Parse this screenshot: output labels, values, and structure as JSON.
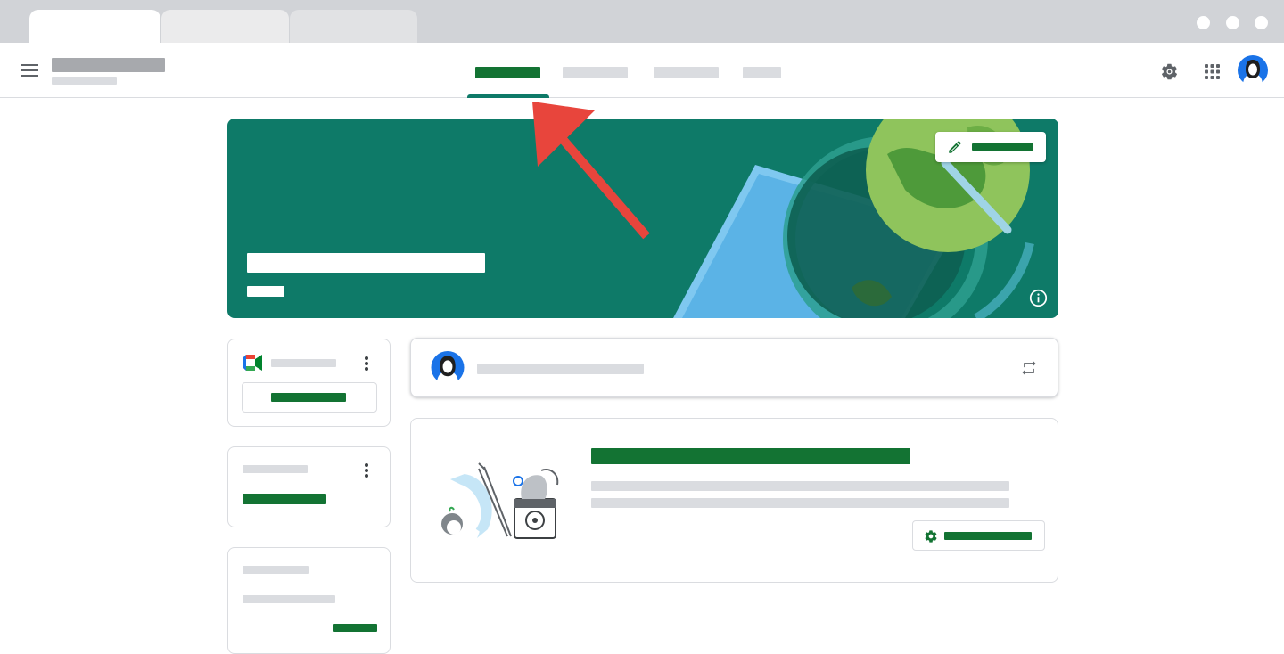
{
  "browser": {
    "tabs": [
      "",
      "",
      ""
    ],
    "window_controls": [
      "",
      "",
      ""
    ]
  },
  "header": {
    "menu_icon": "hamburger-menu-icon",
    "class_name": "",
    "class_section": "",
    "nav_tabs": [
      {
        "label": "",
        "active": true
      },
      {
        "label": "",
        "active": false
      },
      {
        "label": "",
        "active": false
      },
      {
        "label": "",
        "active": false
      }
    ],
    "icons": [
      "gear-icon",
      "apps-grid-icon",
      "avatar"
    ]
  },
  "banner": {
    "title": "",
    "subtitle": "",
    "customize_label": "",
    "background": "#0e7a68",
    "icons": [
      "pencil-icon",
      "info-icon"
    ]
  },
  "meet_card": {
    "title": "",
    "button_label": "",
    "icon": "google-meet-icon"
  },
  "upcoming_card": {
    "title": "",
    "value": ""
  },
  "third_card": {
    "title": "",
    "line": "",
    "link": ""
  },
  "announce": {
    "placeholder": "",
    "icons": [
      "avatar",
      "repost-icon"
    ]
  },
  "info_card": {
    "heading": "",
    "body_lines": [
      "",
      ""
    ],
    "button_label": "",
    "icons": [
      "gear-icon"
    ]
  },
  "colors": {
    "accent_green": "#137333",
    "banner_teal": "#0e7a68",
    "arrow_red": "#e8453c",
    "placeholder_grey": "#dadce0"
  }
}
